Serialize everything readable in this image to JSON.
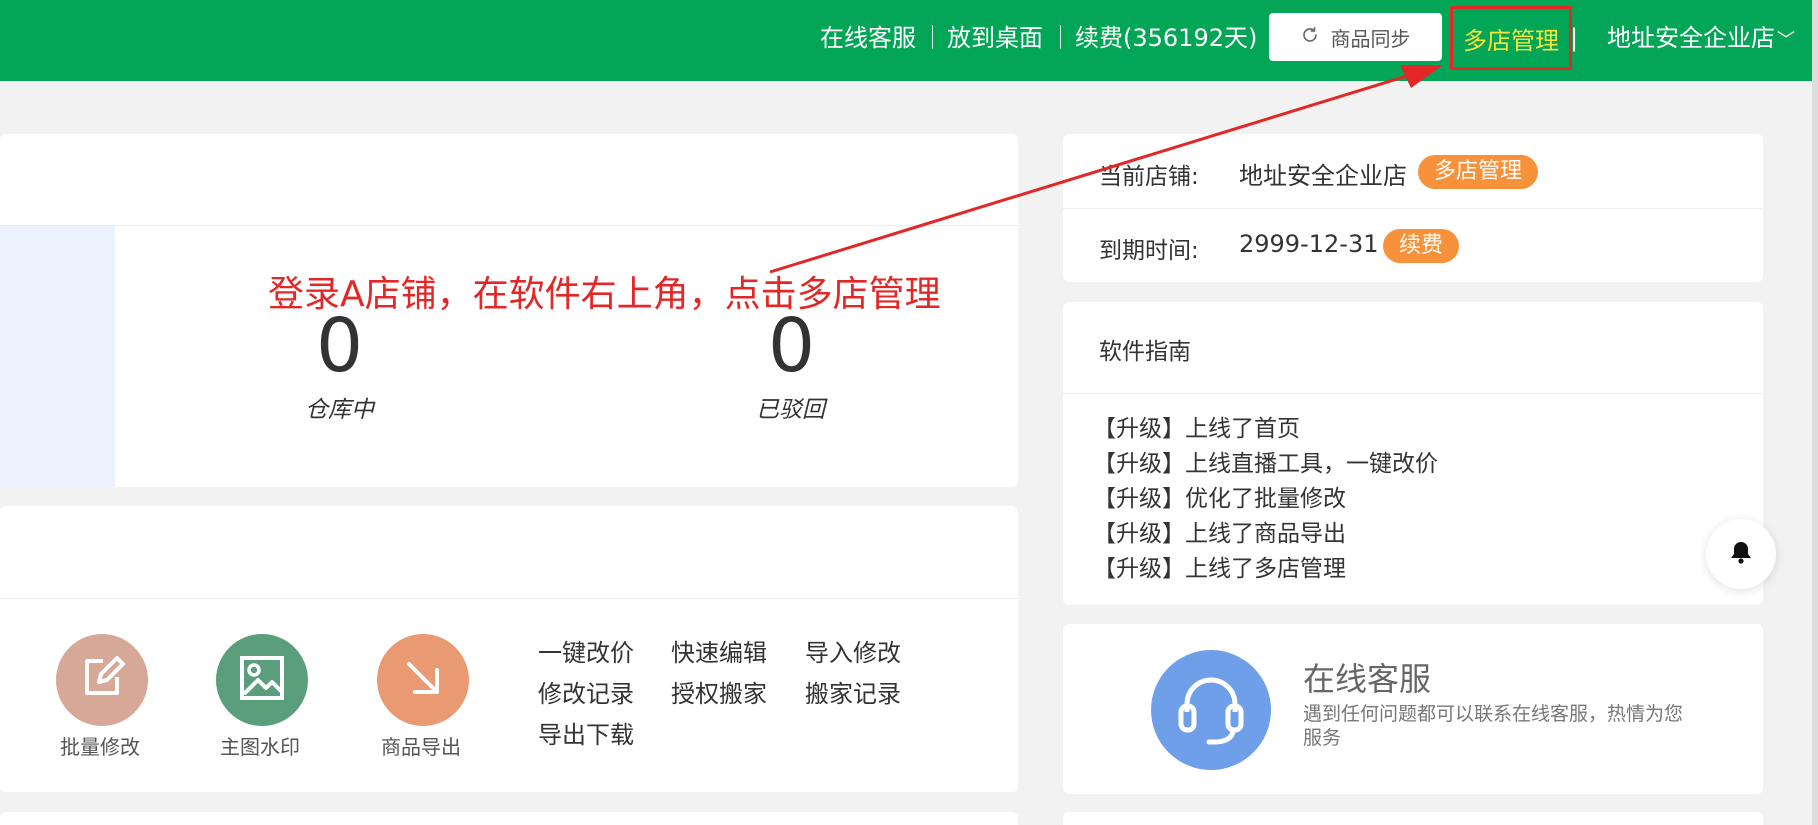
{
  "header": {
    "nav_links": [
      "在线客服",
      "放到桌面",
      "续费(356192天)"
    ],
    "sync_button": {
      "icon": "refresh-icon",
      "label": "商品同步"
    },
    "multi_store_label": "多店管理",
    "separator_after_multi": "|",
    "store_name": "地址安全企业店",
    "chevron": "﹀",
    "colors": {
      "bg": "#03a657",
      "highlight": "#f7e53d",
      "box": "#e32727"
    }
  },
  "stats": {
    "items": [
      {
        "value": "0",
        "label": "仓库中"
      },
      {
        "value": "0",
        "label": "已驳回"
      }
    ]
  },
  "annotation": {
    "text": "登录A店铺，在软件右上角，点击多店管理",
    "color": "#e32727"
  },
  "tools": {
    "items": [
      {
        "label": "批量修改",
        "icon": "edit-icon",
        "color": "#d6a898"
      },
      {
        "label": "主图水印",
        "icon": "image-icon",
        "color": "#5a9e7b"
      },
      {
        "label": "商品导出",
        "icon": "arrow-down-right-icon",
        "color": "#e99a73"
      }
    ],
    "quick_links": [
      "一键改价",
      "快速编辑",
      "导入修改",
      "修改记录",
      "授权搬家",
      "搬家记录",
      "导出下载"
    ]
  },
  "store_info": {
    "current_label": "当前店铺:",
    "current_value": "地址安全企业店",
    "current_badge": "多店管理",
    "expiry_label": "到期时间:",
    "expiry_value": "2999-12-31",
    "expiry_badge": "续费",
    "badge_color": "#f7913a"
  },
  "guide": {
    "title": "软件指南",
    "items": [
      "【升级】上线了首页",
      "【升级】上线直播工具，一键改价",
      "【升级】优化了批量修改",
      "【升级】上线了商品导出",
      "【升级】上线了多店管理"
    ]
  },
  "service": {
    "title": "在线客服",
    "description": "遇到任何问题都可以联系在线客服，热情为您服务",
    "icon": "headset-icon",
    "color": "#6f9fe9"
  },
  "floating": {
    "icon": "bell-icon"
  }
}
